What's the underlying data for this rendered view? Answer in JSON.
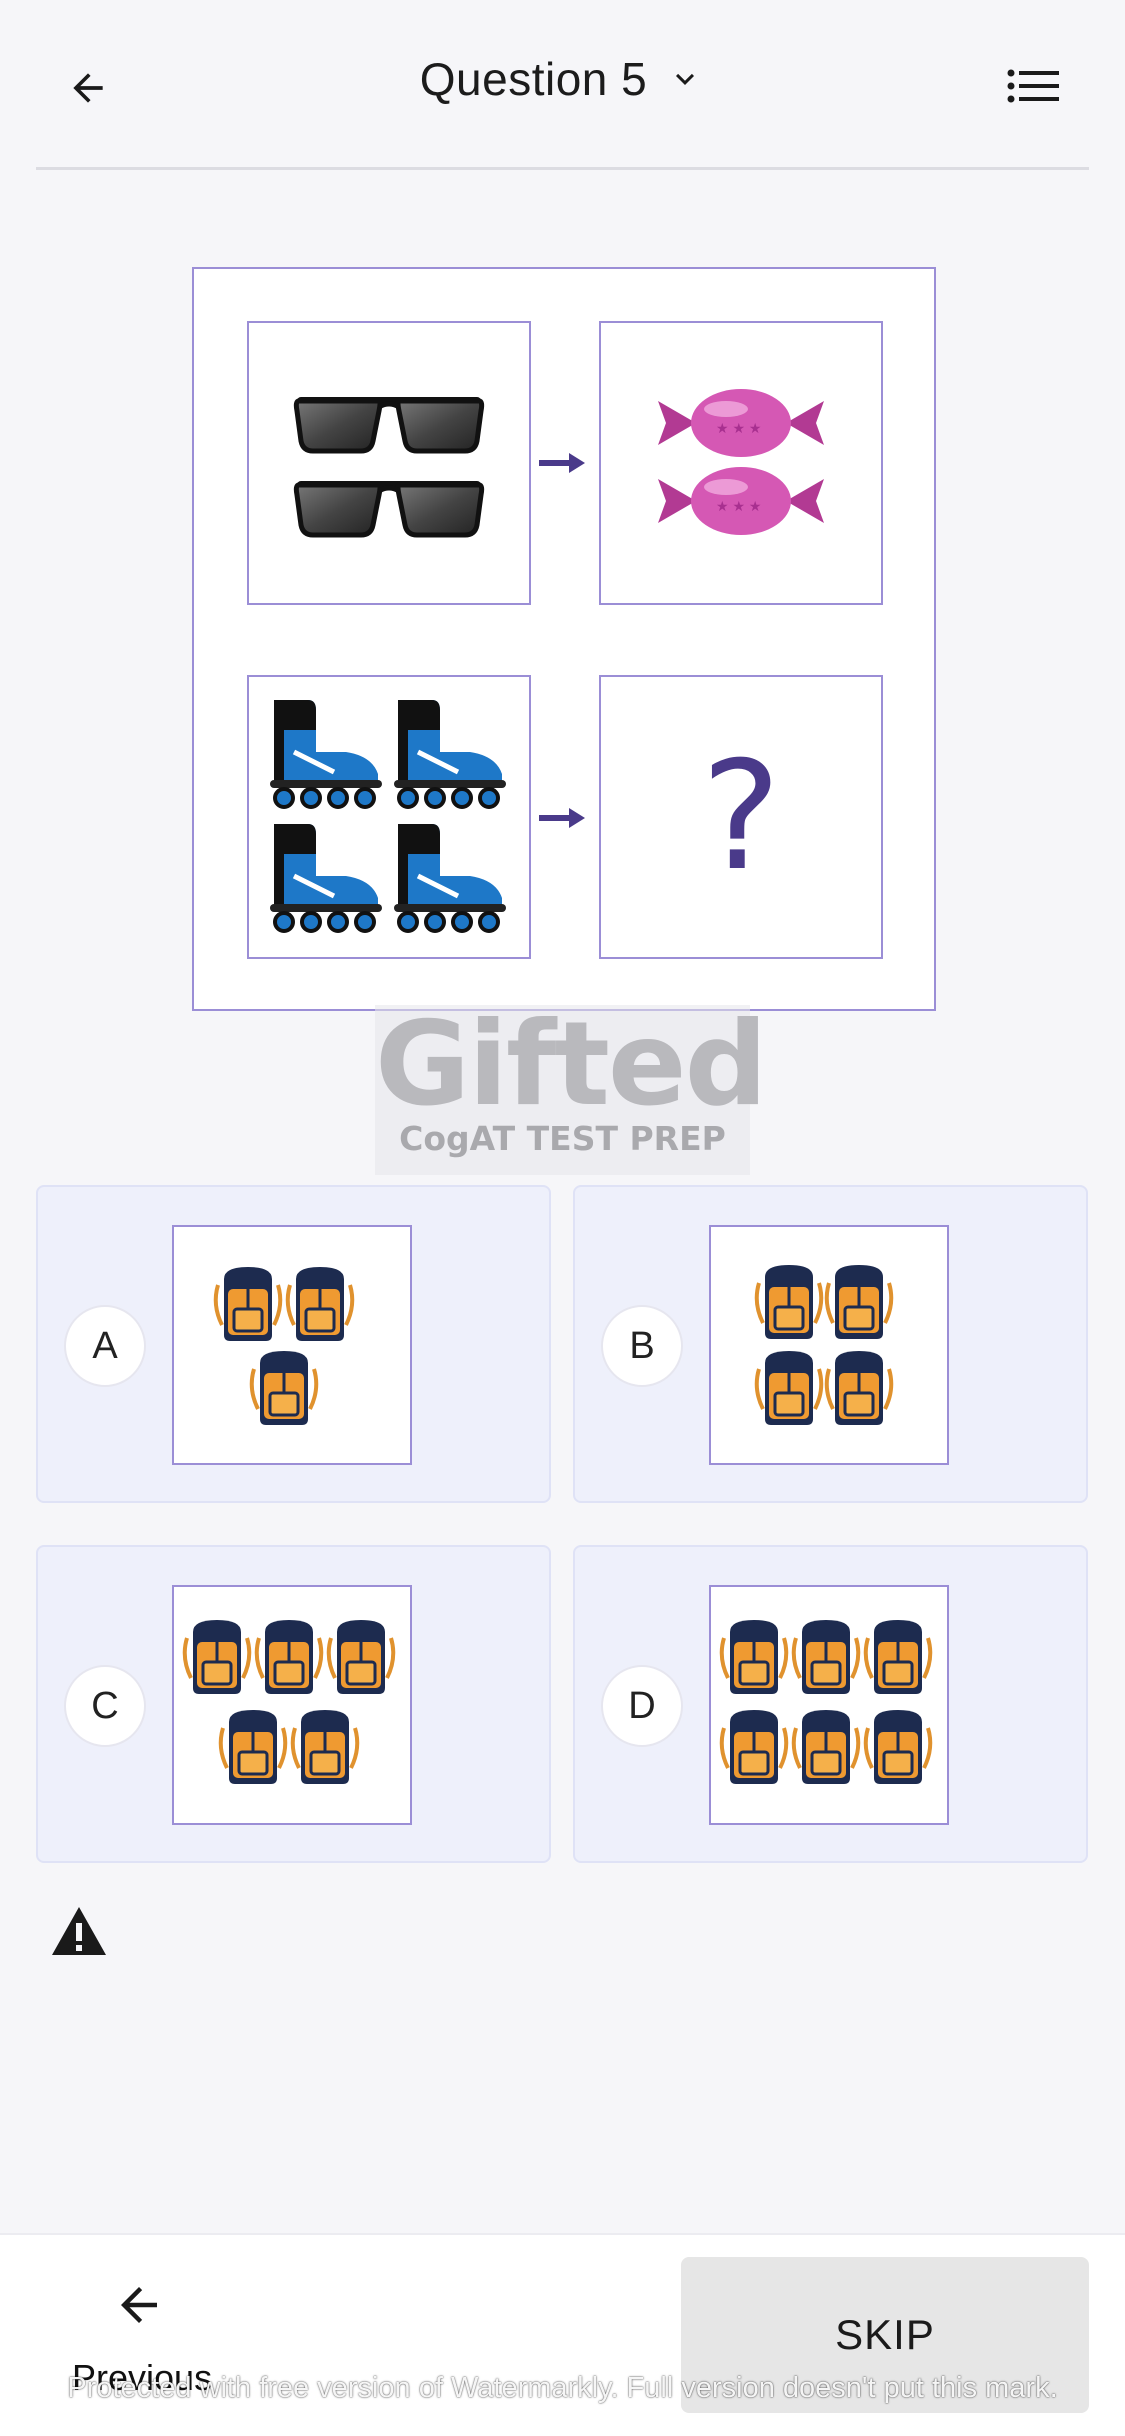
{
  "header": {
    "title": "Question 5",
    "back_icon": "arrow-left-icon",
    "dropdown_icon": "chevron-down-icon",
    "menu_icon": "list-icon"
  },
  "question": {
    "pairs": [
      {
        "left": {
          "item": "sunglasses",
          "count": 2
        },
        "right": {
          "item": "candy",
          "count": 2
        }
      },
      {
        "left": {
          "item": "roller-skates",
          "count": 4
        },
        "right": {
          "unknown": true,
          "symbol": "?"
        }
      }
    ]
  },
  "brand": {
    "main": "Gifted",
    "sub": "CogAT TEST PREP"
  },
  "options": [
    {
      "letter": "A",
      "item": "backpack",
      "count": 3
    },
    {
      "letter": "B",
      "item": "backpack",
      "count": 4
    },
    {
      "letter": "C",
      "item": "backpack",
      "count": 5
    },
    {
      "letter": "D",
      "item": "backpack",
      "count": 6
    }
  ],
  "footer": {
    "previous_label": "Previous",
    "skip_label": "SKIP",
    "watermark": "Protected with free version of Watermarkly. Full version doesn't put this mark."
  },
  "colors": {
    "accent": "#9b8ed6",
    "option_bg": "#eef0fb",
    "arrow": "#4a3a8a"
  }
}
